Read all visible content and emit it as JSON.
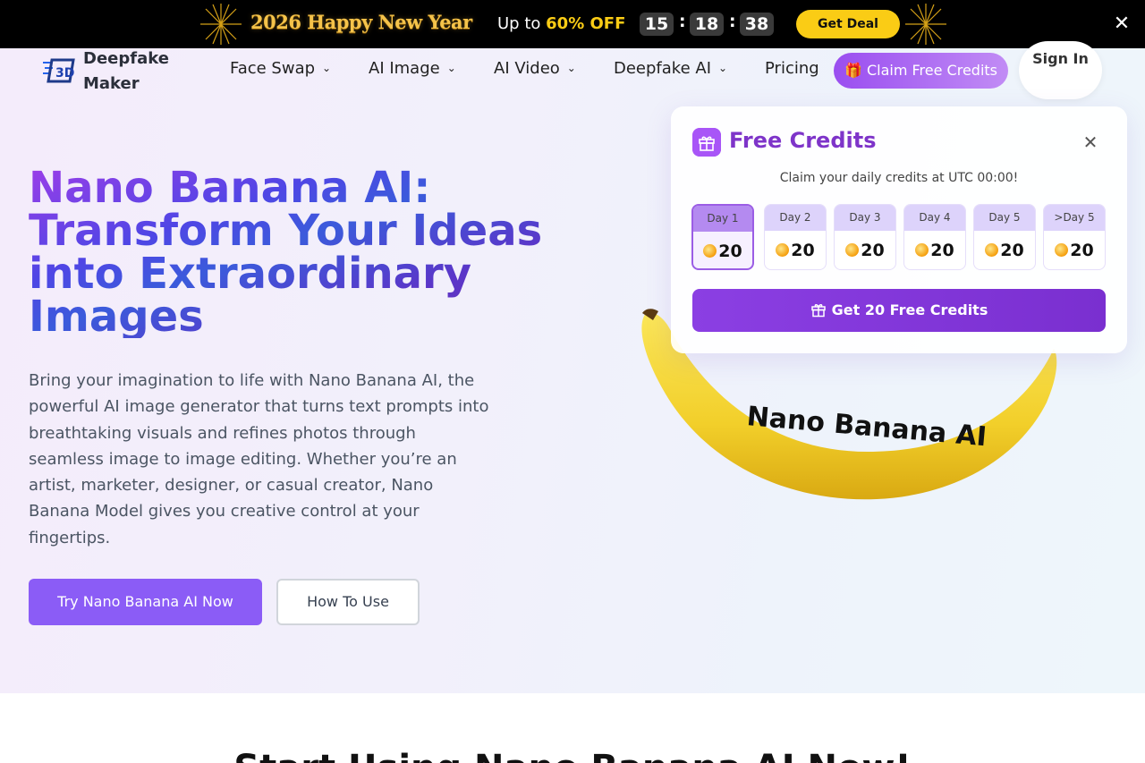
{
  "promo": {
    "title": "2026 Happy New Year",
    "offer_prefix": "Up to",
    "offer_highlight": "60% OFF",
    "countdown": {
      "hours": "15",
      "minutes": "18",
      "seconds": "38"
    },
    "deal_label": "Get Deal",
    "close_glyph": "✕"
  },
  "brand": {
    "name": "Deepfake Maker"
  },
  "nav": {
    "items": [
      {
        "label": "Face Swap"
      },
      {
        "label": "AI Image"
      },
      {
        "label": "AI Video"
      },
      {
        "label": "Deepfake AI"
      },
      {
        "label": "Pricing"
      }
    ],
    "chevron_glyph": "⌄",
    "claim_label": "🎁 Claim Free Credits",
    "signin_label": "Sign In"
  },
  "hero": {
    "title": "Nano Banana AI: Transform Your Ideas into Extraordinary Images",
    "description": "Bring your imagination to life with Nano Banana AI, the powerful AI image generator that turns text prompts into breathtaking visuals and refines photos through seamless image to image editing. Whether you’re an artist, marketer, designer, or casual creator, Nano Banana Model gives you creative control at your fingertips.",
    "primary_cta": "Try Nano Banana AI Now",
    "secondary_cta": "How To Use",
    "image_text": "Nano Banana AI"
  },
  "credits_popup": {
    "title": "Free Credits",
    "subtitle": "Claim your daily credits at UTC 00:00!",
    "days": [
      {
        "label": "Day 1",
        "value": "20"
      },
      {
        "label": "Day 2",
        "value": "20"
      },
      {
        "label": "Day 3",
        "value": "20"
      },
      {
        "label": "Day 4",
        "value": "20"
      },
      {
        "label": "Day 5",
        "value": "20"
      },
      {
        "label": ">Day 5",
        "value": "20"
      }
    ],
    "active_day": 1,
    "button_label": "Get 20 Free Credits",
    "close_glyph": "✕"
  },
  "next_section": {
    "title": "Start Using Nano Banana AI Now!"
  },
  "colors": {
    "accent": "#8b5cf6",
    "deal_yellow": "#facc15",
    "popup_title": "#7e34c9"
  }
}
